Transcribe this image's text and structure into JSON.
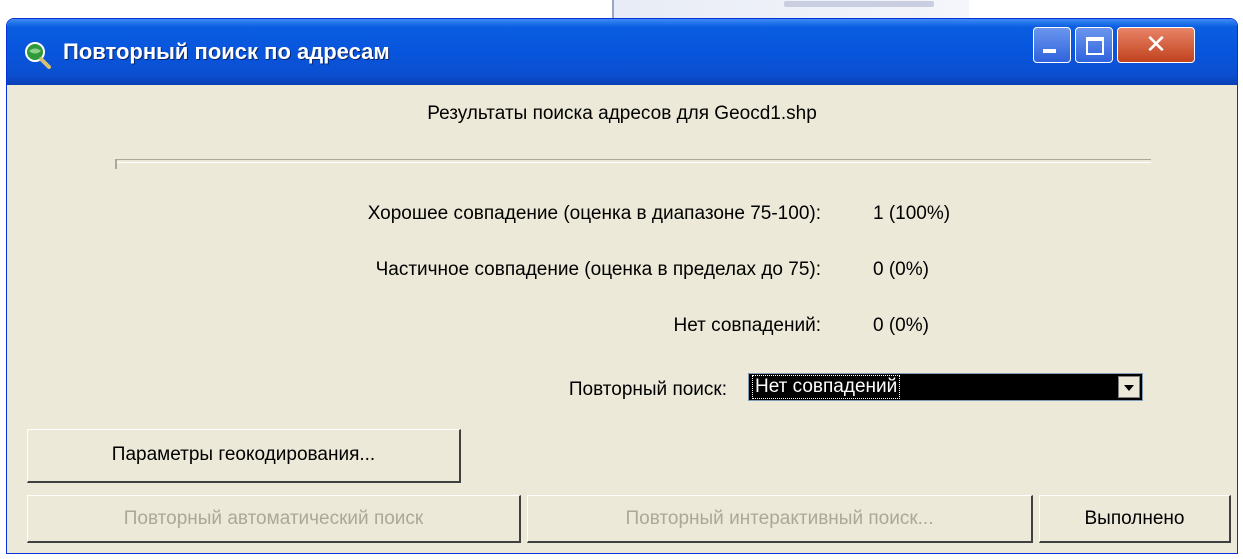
{
  "window": {
    "title": "Повторный поиск по адресам"
  },
  "heading": "Результаты поиска адресов для Geocd1.shp",
  "stats": [
    {
      "label": "Хорошее совпадение (оценка в диапазоне 75-100):",
      "value": "1 (100%)"
    },
    {
      "label": "Частичное совпадение (оценка в пределах до 75):",
      "value": "0 (0%)"
    },
    {
      "label": "Нет совпадений:",
      "value": "0 (0%)"
    }
  ],
  "rematch": {
    "label": "Повторный поиск:",
    "selected": "Нет совпадений"
  },
  "buttons": {
    "params": "Параметры геокодирования...",
    "auto": "Повторный автоматический поиск",
    "interactive": "Повторный интерактивный поиск...",
    "done": "Выполнено"
  },
  "colors": {
    "titlebar": "#0855dd",
    "dialog_bg": "#ece9d8",
    "close_button": "#c0411e",
    "disabled_text": "#aca899"
  },
  "icons": {
    "app": "magnifier-globe-icon",
    "minimize": "minimize-icon",
    "maximize": "maximize-icon",
    "close": "close-icon",
    "dropdown": "chevron-down-icon"
  }
}
